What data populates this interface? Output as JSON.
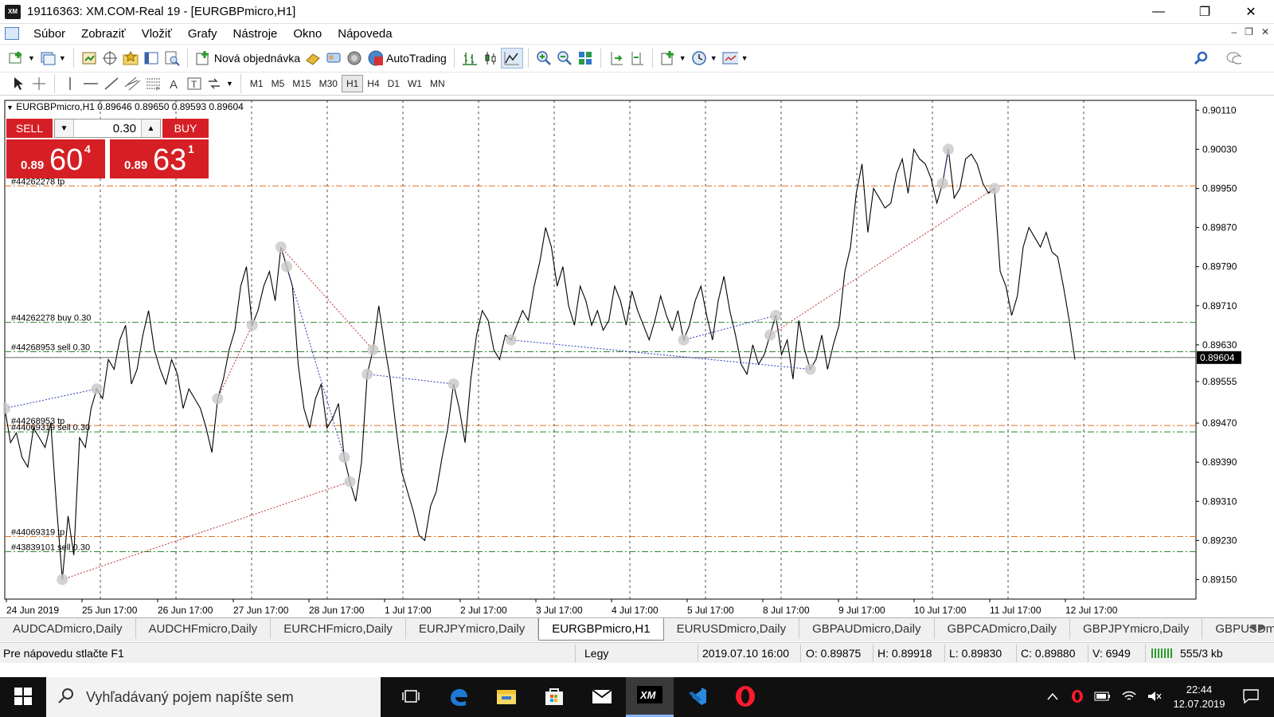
{
  "window": {
    "title": "19116363: XM.COM-Real 19 - [EURGBPmicro,H1]",
    "app_icon_text": "XM",
    "controls": [
      "minimize",
      "maximize",
      "close"
    ]
  },
  "menu": {
    "items": [
      "Súbor",
      "Zobraziť",
      "Vložiť",
      "Grafy",
      "Nástroje",
      "Okno",
      "Nápoveda"
    ]
  },
  "toolbar": {
    "new_order_label": "Nová objednávka",
    "autotrading_label": "AutoTrading"
  },
  "timeframes": [
    "M1",
    "M5",
    "M15",
    "M30",
    "H1",
    "H4",
    "D1",
    "W1",
    "MN"
  ],
  "active_timeframe": "H1",
  "chart_header": "EURGBPmicro,H1  0.89646 0.89650 0.89593 0.89604",
  "one_click": {
    "sell_label": "SELL",
    "buy_label": "BUY",
    "volume": "0.30",
    "sell_small": "0.89",
    "sell_big": "60",
    "sell_sup": "4",
    "buy_small": "0.89",
    "buy_big": "63",
    "buy_sup": "1"
  },
  "chart_data": {
    "type": "line",
    "symbol": "EURGBPmicro",
    "timeframe": "H1",
    "ylim": [
      0.8911,
      0.9013
    ],
    "y_ticks": [
      "0.90110",
      "0.90030",
      "0.89950",
      "0.89870",
      "0.89790",
      "0.89710",
      "0.89630",
      "0.89555",
      "0.89470",
      "0.89390",
      "0.89310",
      "0.89230",
      "0.89150"
    ],
    "x_ticks": [
      "24 Jun 2019",
      "25 Jun 17:00",
      "26 Jun 17:00",
      "27 Jun 17:00",
      "28 Jun 17:00",
      "1 Jul 17:00",
      "2 Jul 17:00",
      "3 Jul 17:00",
      "4 Jul 17:00",
      "5 Jul 17:00",
      "8 Jul 17:00",
      "9 Jul 17:00",
      "10 Jul 17:00",
      "11 Jul 17:00",
      "12 Jul 17:00"
    ],
    "current_price": "0.89604",
    "close_series": [
      0.895,
      0.8943,
      0.8945,
      0.894,
      0.8938,
      0.8946,
      0.8944,
      0.8942,
      0.8947,
      0.893,
      0.8915,
      0.8928,
      0.892,
      0.8944,
      0.8942,
      0.895,
      0.8954,
      0.8952,
      0.896,
      0.8958,
      0.8964,
      0.8967,
      0.8955,
      0.8958,
      0.8965,
      0.897,
      0.8962,
      0.8958,
      0.8955,
      0.896,
      0.8957,
      0.895,
      0.8954,
      0.8952,
      0.895,
      0.8946,
      0.8941,
      0.8952,
      0.8956,
      0.8962,
      0.8966,
      0.8975,
      0.8979,
      0.8967,
      0.897,
      0.8975,
      0.8978,
      0.8972,
      0.8983,
      0.8979,
      0.8975,
      0.8959,
      0.895,
      0.8946,
      0.8952,
      0.8955,
      0.8946,
      0.8948,
      0.8951,
      0.894,
      0.8935,
      0.8931,
      0.8939,
      0.8957,
      0.8962,
      0.8971,
      0.8963,
      0.8956,
      0.8946,
      0.8937,
      0.8933,
      0.8929,
      0.8924,
      0.8923,
      0.893,
      0.8933,
      0.894,
      0.8946,
      0.8955,
      0.895,
      0.8943,
      0.8956,
      0.8965,
      0.897,
      0.8968,
      0.8962,
      0.896,
      0.8965,
      0.8964,
      0.8967,
      0.897,
      0.8968,
      0.8975,
      0.898,
      0.8987,
      0.8983,
      0.8975,
      0.8979,
      0.8971,
      0.8967,
      0.8975,
      0.8972,
      0.8967,
      0.897,
      0.8966,
      0.8968,
      0.8975,
      0.8972,
      0.8967,
      0.8974,
      0.897,
      0.8967,
      0.8964,
      0.8968,
      0.8973,
      0.8969,
      0.8966,
      0.897,
      0.8964,
      0.8967,
      0.8972,
      0.8975,
      0.8969,
      0.8964,
      0.8972,
      0.8977,
      0.897,
      0.8965,
      0.8959,
      0.8957,
      0.8963,
      0.8959,
      0.8961,
      0.8965,
      0.8969,
      0.8961,
      0.8964,
      0.8956,
      0.8968,
      0.8962,
      0.8958,
      0.896,
      0.8965,
      0.8958,
      0.8963,
      0.8967,
      0.8978,
      0.8983,
      0.8994,
      0.9,
      0.8986,
      0.8995,
      0.8993,
      0.8991,
      0.8992,
      0.8998,
      0.9001,
      0.8994,
      0.9003,
      0.9001,
      0.9,
      0.8997,
      0.8992,
      0.8996,
      0.9003,
      0.8993,
      0.8995,
      0.9001,
      0.9002,
      0.9,
      0.8996,
      0.8994,
      0.8995,
      0.8978,
      0.8975,
      0.8969,
      0.8973,
      0.8983,
      0.8987,
      0.8985,
      0.8983,
      0.8986,
      0.8982,
      0.8981,
      0.8975,
      0.8968,
      0.896
    ]
  },
  "orders": [
    {
      "label": "#44262278 tp",
      "price": 0.89955,
      "color": "#e07020"
    },
    {
      "label": "#44262278 buy 0.30",
      "price": 0.89676,
      "color": "#2a8a2a"
    },
    {
      "label": "#44268953 sell 0.30",
      "price": 0.89616,
      "color": "#2a8a2a"
    },
    {
      "label": "#44268953 tp",
      "price": 0.89465,
      "color": "#e07020"
    },
    {
      "label": "#44069319 sell 0.30",
      "price": 0.89452,
      "color": "#2a8a2a"
    },
    {
      "label": "#44069319 tp",
      "price": 0.89238,
      "color": "#e07020"
    },
    {
      "label": "#43839101 sell 0.30",
      "price": 0.89207,
      "color": "#2a8a2a"
    }
  ],
  "tabs": [
    "AUDCADmicro,Daily",
    "AUDCHFmicro,Daily",
    "EURCHFmicro,Daily",
    "EURJPYmicro,Daily",
    "EURGBPmicro,H1",
    "EURUSDmicro,Daily",
    "GBPAUDmicro,Daily",
    "GBPCADmicro,Daily",
    "GBPJPYmicro,Daily",
    "GBPUSDmicro,Daily"
  ],
  "active_tab": "EURGBPmicro,H1",
  "status": {
    "help": "Pre nápovedu stlačte F1",
    "profile": "Legy",
    "datetime": "2019.07.10 16:00",
    "open": "O: 0.89875",
    "high": "H: 0.89918",
    "low": "L: 0.89830",
    "close": "C: 0.89880",
    "volume": "V: 6949",
    "traffic": "555/3 kb"
  },
  "taskbar": {
    "search_placeholder": "Vyhľadávaný pojem napíšte sem",
    "time": "22:44",
    "date": "12.07.2019"
  }
}
